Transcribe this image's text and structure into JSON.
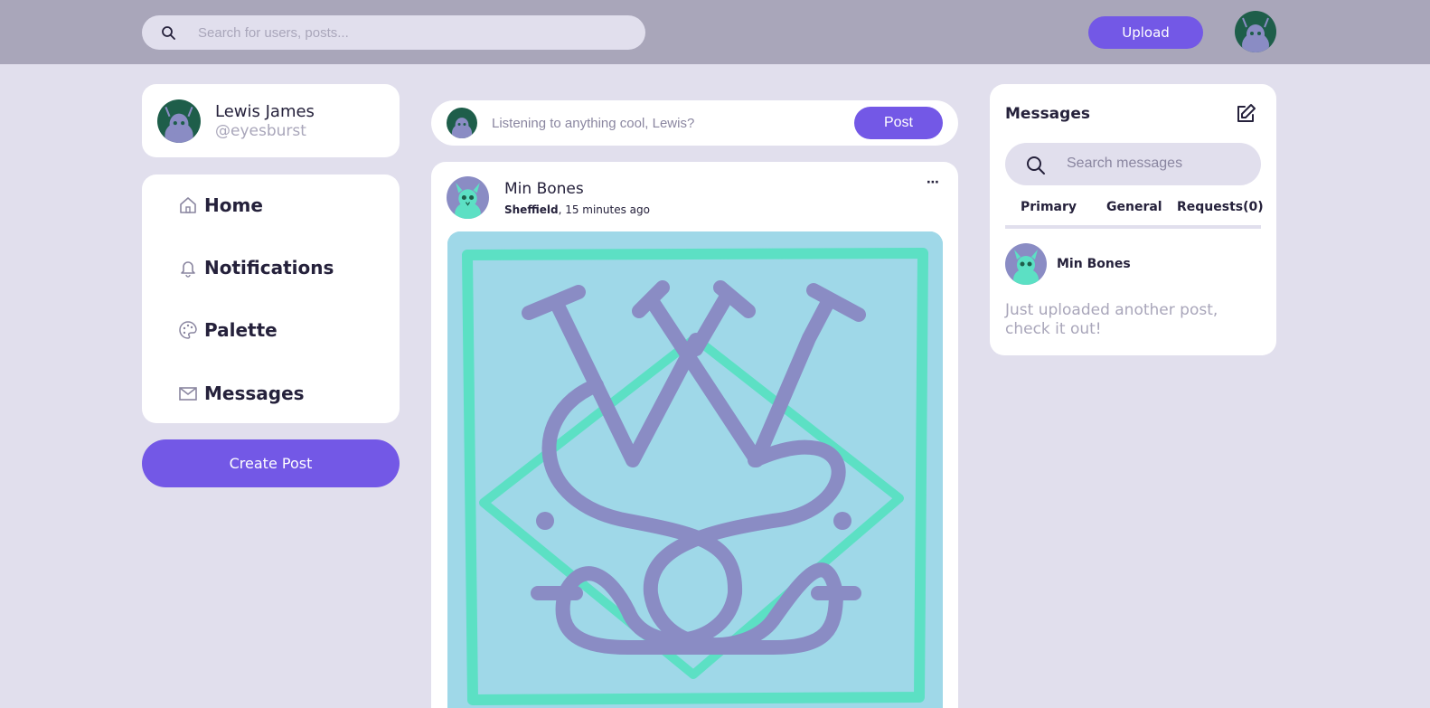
{
  "header": {
    "search": {
      "placeholder": "Search for users, posts..."
    },
    "upload_label": "Upload",
    "user_avatar_icon": "owl-avatar-icon"
  },
  "profile": {
    "name": "Lewis James",
    "handle": "@eyesburst"
  },
  "nav": {
    "items": [
      {
        "label": "Home",
        "icon": "home-icon"
      },
      {
        "label": "Notifications",
        "icon": "bell-icon"
      },
      {
        "label": "Palette",
        "icon": "palette-icon"
      },
      {
        "label": "Messages",
        "icon": "mail-icon"
      }
    ],
    "create_label": "Create Post"
  },
  "composer": {
    "placeholder": "Listening to anything cool, Lewis?",
    "post_label": "Post"
  },
  "post": {
    "author": "Min Bones",
    "location": "Sheffield",
    "time": ", 15 minutes ago",
    "more": "⋯",
    "image_icon": "crest-artwork"
  },
  "messages": {
    "title": "Messages",
    "search": {
      "placeholder": "Search messages"
    },
    "tabs": [
      "Primary",
      "General",
      "Requests(0)"
    ],
    "threads": [
      {
        "sender": "Min Bones",
        "preview": "Just uploaded another post, check it out!"
      }
    ]
  },
  "colors": {
    "accent": "#7358e6",
    "topbar": "#a9a6ba",
    "background": "#e1dfed",
    "text": "#25213b",
    "muted": "#a9a6ba",
    "teal": "#5ce0c4",
    "image_bg": "#9fd8e8",
    "art_purple": "#8a8cc4"
  }
}
